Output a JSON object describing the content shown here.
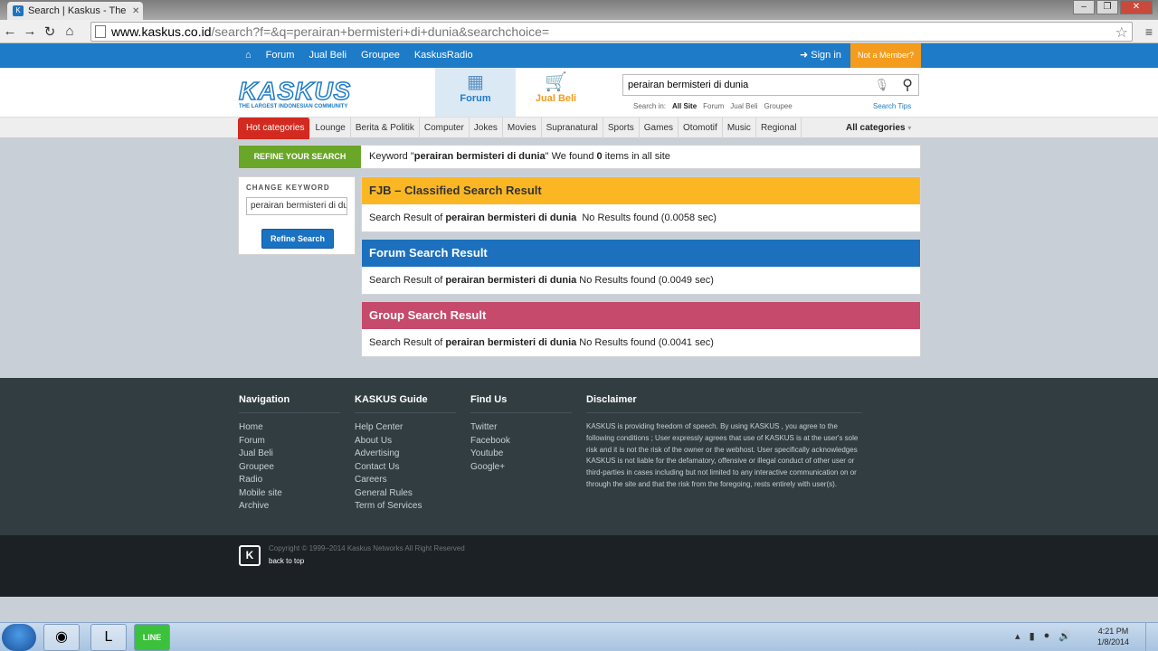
{
  "browser": {
    "tab_title": "Search | Kaskus - The Larg",
    "url_host": "www.kaskus.co.id",
    "url_path": "/search?f=&q=perairan+bermisteri+di+dunia&searchchoice="
  },
  "topnav": {
    "items": [
      "Forum",
      "Jual Beli",
      "Groupee",
      "KaskusRadio"
    ],
    "sign_in": "Sign in",
    "not_member": "Not a Member?"
  },
  "header": {
    "logo_text": "KASKUS",
    "logo_tagline": "THE LARGEST INDONESIAN COMMUNITY",
    "tab_forum": "Forum",
    "tab_jualbeli": "Jual Beli",
    "search_value": "perairan bermisteri di dunia",
    "search_in_label": "Search in:",
    "search_in_options": [
      "All Site",
      "Forum",
      "Jual Beli",
      "Groupee"
    ],
    "search_tips": "Search Tips"
  },
  "categories": {
    "items": [
      "Hot categories",
      "Lounge",
      "Berita & Politik",
      "Computer",
      "Jokes",
      "Movies",
      "Supranatural",
      "Sports",
      "Games",
      "Otomotif",
      "Music",
      "Regional"
    ],
    "all": "All categories"
  },
  "keyword_bar": {
    "refine_label": "REFINE YOUR SEARCH",
    "prefix": "Keyword \"",
    "keyword": "perairan bermisteri di dunia",
    "middle": "\" We found ",
    "count": "0",
    "suffix": " items in all site"
  },
  "sidebar": {
    "change_keyword": "CHANGE KEYWORD",
    "input_value": "perairan bermisteri di dunia",
    "refine_button": "Refine Search"
  },
  "results": [
    {
      "title": "FJB – Classified Search Result",
      "prefix": "Search Result of ",
      "keyword": "perairan bermisteri di dunia",
      "status": "  No Results found (0.0058 sec)"
    },
    {
      "title": "Forum Search Result",
      "prefix": "Search Result of ",
      "keyword": "perairan bermisteri di dunia",
      "status": " No Results found (0.0049 sec)"
    },
    {
      "title": "Group Search Result",
      "prefix": "Search Result of ",
      "keyword": "perairan bermisteri di dunia",
      "status": " No Results found (0.0041 sec)"
    }
  ],
  "footer": {
    "navigation": {
      "title": "Navigation",
      "items": [
        "Home",
        "Forum",
        "Jual Beli",
        "Groupee",
        "Radio",
        "Mobile site",
        "Archive"
      ]
    },
    "guide": {
      "title": "KASKUS Guide",
      "items": [
        "Help Center",
        "About Us",
        "Advertising",
        "Contact Us",
        "Careers",
        "General Rules",
        "Term of Services"
      ]
    },
    "findus": {
      "title": "Find Us",
      "items": [
        "Twitter",
        "Facebook",
        "Youtube",
        "Google+"
      ]
    },
    "disclaimer": {
      "title": "Disclaimer",
      "text": "KASKUS is providing freedom of speech. By using KASKUS , you agree to the following conditions ; User expressly agrees that use of KASKUS is at the user's sole risk and it is not the risk of the owner or the webhost. User specifically acknowledges KASKUS is not liable for the defamatory, offensive or illegal conduct of other user or third-parties in cases including but not limited to any interactive communication on or through the site and that the risk from the foregoing, rests entirely with user(s)."
    },
    "copyright": "Copyright © 1999–2014 Kaskus Networks All Right Reserved",
    "back_to_top": "back to top"
  },
  "taskbar": {
    "time": "4:21 PM",
    "date": "1/8/2014"
  }
}
